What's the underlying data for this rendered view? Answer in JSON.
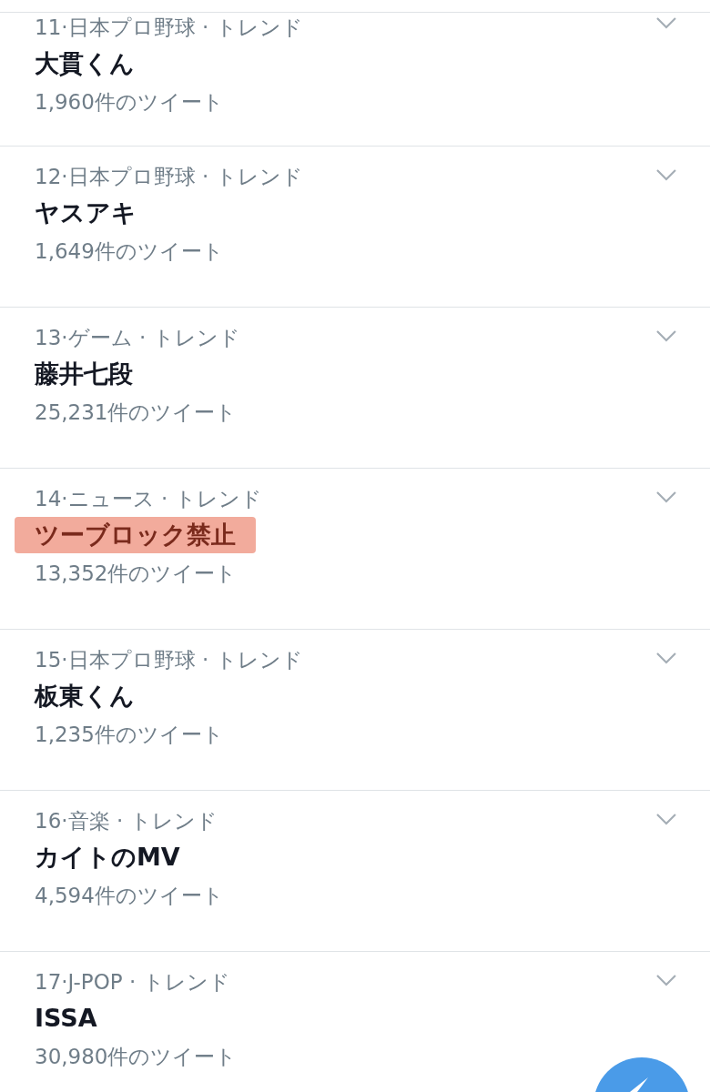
{
  "trends": [
    {
      "meta": "11·日本プロ野球 · トレンド",
      "title": "大貫くん",
      "count": "1,960件のツイート",
      "highlighted": false
    },
    {
      "meta": "12·日本プロ野球 · トレンド",
      "title": "ヤスアキ",
      "count": "1,649件のツイート",
      "highlighted": false
    },
    {
      "meta": "13·ゲーム · トレンド",
      "title": "藤井七段",
      "count": "25,231件のツイート",
      "highlighted": false
    },
    {
      "meta": "14·ニュース · トレンド",
      "title": "ツーブロック禁止",
      "count": "13,352件のツイート",
      "highlighted": true
    },
    {
      "meta": "15·日本プロ野球 · トレンド",
      "title": "板東くん",
      "count": "1,235件のツイート",
      "highlighted": false
    },
    {
      "meta": "16·音楽 · トレンド",
      "title": "カイトのMV",
      "count": "4,594件のツイート",
      "highlighted": false
    },
    {
      "meta": "17·J-POP · トレンド",
      "title": "ISSA",
      "count": "30,980件のツイート",
      "highlighted": false
    }
  ]
}
